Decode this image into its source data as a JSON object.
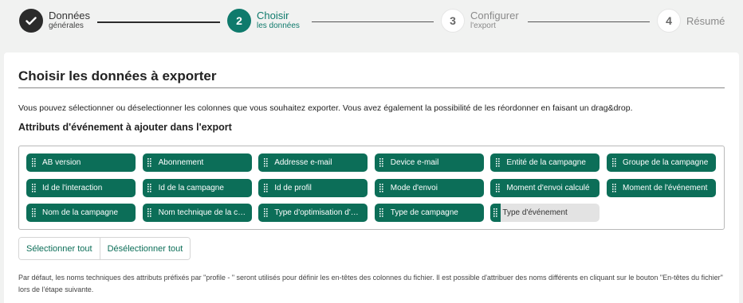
{
  "stepper": {
    "steps": [
      {
        "number": "",
        "title": "Données",
        "subtitle": "générales",
        "state": "done"
      },
      {
        "number": "2",
        "title": "Choisir",
        "subtitle": "les données",
        "state": "active"
      },
      {
        "number": "3",
        "title": "Configurer",
        "subtitle": "l'export",
        "state": "todo"
      },
      {
        "number": "4",
        "title": "Résumé",
        "subtitle": "",
        "state": "todo"
      }
    ]
  },
  "card": {
    "title": "Choisir les données à exporter",
    "description": "Vous pouvez sélectionner ou déselectionner les colonnes que vous souhaitez exporter. Vous avez également la possibilité de les réordonner en faisant un drag&drop.",
    "attributes_title": "Attributs d'événement à ajouter dans l'export",
    "attributes": [
      {
        "label": "AB version",
        "selected": true
      },
      {
        "label": "Abonnement",
        "selected": true
      },
      {
        "label": "Addresse e-mail",
        "selected": true
      },
      {
        "label": "Device e-mail",
        "selected": true
      },
      {
        "label": "Entité de la campagne",
        "selected": true
      },
      {
        "label": "Groupe de la campagne",
        "selected": true
      },
      {
        "label": "Id de l'interaction",
        "selected": true
      },
      {
        "label": "Id de la campagne",
        "selected": true
      },
      {
        "label": "Id de profil",
        "selected": true
      },
      {
        "label": "Mode d'envoi",
        "selected": true
      },
      {
        "label": "Moment d'envoi calculé",
        "selected": true
      },
      {
        "label": "Moment de l'événement",
        "selected": true
      },
      {
        "label": "Nom de la campagne",
        "selected": true
      },
      {
        "label": "Nom technique de la campagne",
        "selected": true
      },
      {
        "label": "Type d'optimisation d'envoi",
        "selected": true
      },
      {
        "label": "Type de campagne",
        "selected": true
      },
      {
        "label": "Type d'événement",
        "selected": false
      }
    ],
    "select_all_label": "Sélectionner tout",
    "deselect_all_label": "Désélectionner tout",
    "footnote": "Par défaut, les noms techniques des attributs préfixés par \"profile - \" seront utilisés pour définir les en-têtes des colonnes du fichier. Il est possible d'attribuer des noms différents en cliquant sur le bouton \"En-têtes du fichier\" lors de l'étape suivante."
  },
  "colors": {
    "accent": "#0f7a6c",
    "chip": "#0c6e58",
    "chip_off": "#e3e3e3",
    "done": "#2b2b2b"
  }
}
